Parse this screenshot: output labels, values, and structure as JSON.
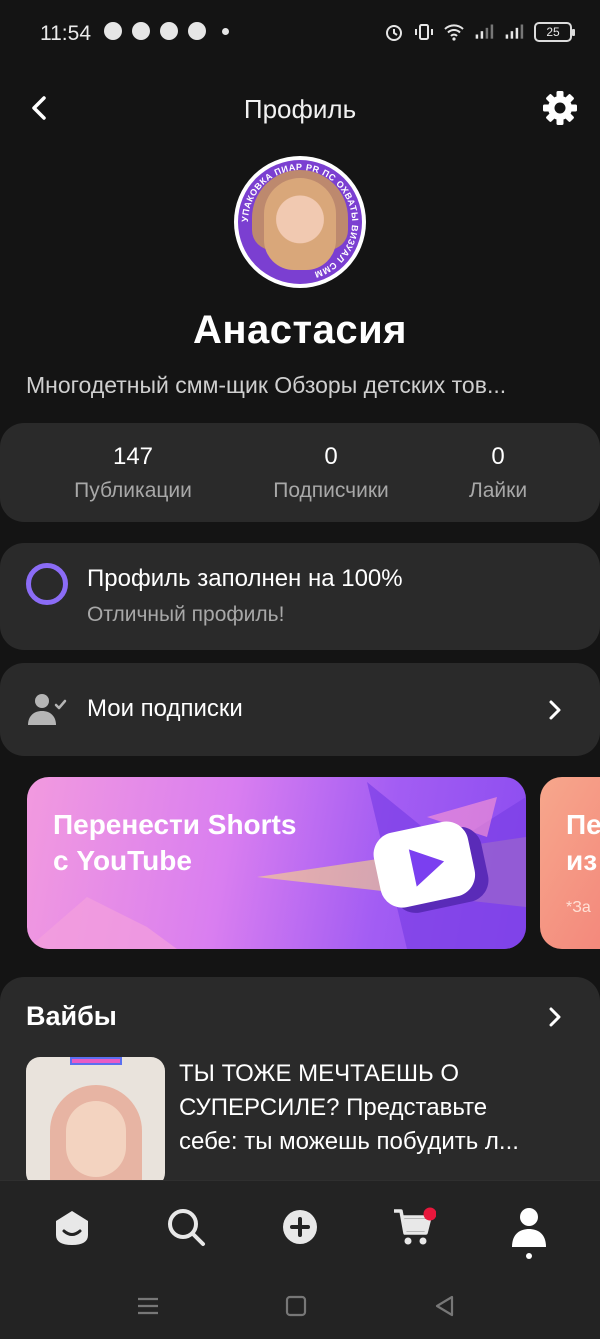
{
  "status_bar": {
    "time": "11:54",
    "battery": "25"
  },
  "header": {
    "title": "Профиль"
  },
  "profile": {
    "avatar_ring_text": "УПАКОВКА ПИАР PR ПС ОХВАТЫ ВИЗУАЛ СММ",
    "name": "Анастасия",
    "bio": "Многодетный смм-щик Обзоры детских тов..."
  },
  "stats": [
    {
      "value": "147",
      "label": "Публикации"
    },
    {
      "value": "0",
      "label": "Подписчики"
    },
    {
      "value": "0",
      "label": "Лайки"
    }
  ],
  "completion": {
    "title": "Профиль заполнен на 100%",
    "subtitle": "Отличный профиль!",
    "percent": 100
  },
  "subscriptions": {
    "label": "Мои подписки"
  },
  "banners": [
    {
      "line1": "Перенести Shorts",
      "line2": "с YouTube"
    },
    {
      "line1": "Пе",
      "line2": "из",
      "note": "*За"
    }
  ],
  "vibes": {
    "title": "Вайбы",
    "item_lines": [
      "ТЫ ТОЖЕ МЕЧТАЕШЬ О",
      "СУПЕРСИЛЕ? Представьте",
      "себе: ты можешь побудить л..."
    ]
  },
  "colors": {
    "accent": "#8b6cf6",
    "notification": "#e8173c"
  }
}
